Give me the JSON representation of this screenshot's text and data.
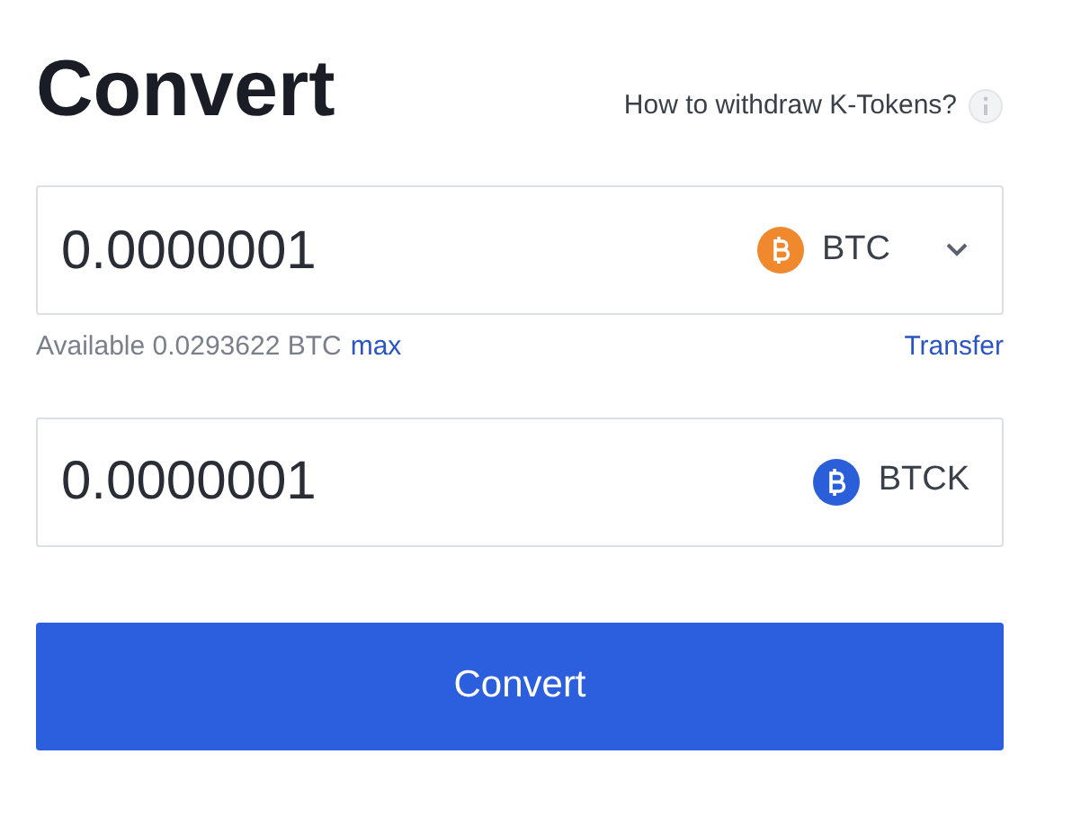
{
  "title": "Convert",
  "help_link": {
    "label": "How to withdraw K-Tokens?"
  },
  "from": {
    "value": "0.0000001",
    "token": "BTC",
    "color": "#f0892e",
    "dropdown": true
  },
  "balance": {
    "label": "Available 0.0293622 BTC",
    "max": "max",
    "transfer": "Transfer"
  },
  "to": {
    "value": "0.0000001",
    "token": "BTCK",
    "color": "#2b5fd9",
    "dropdown": false
  },
  "button": "Convert"
}
